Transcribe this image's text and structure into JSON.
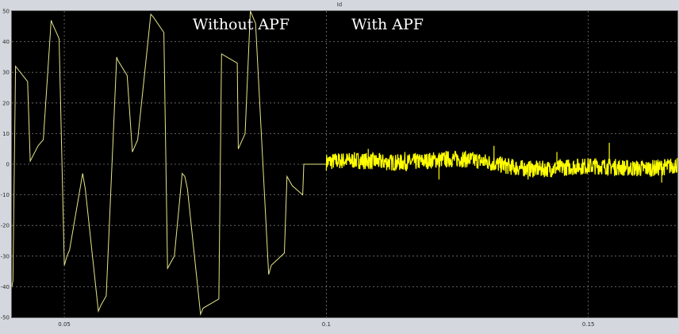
{
  "window": {
    "title": "Id"
  },
  "chart_data": {
    "type": "line",
    "title": "Id",
    "xlabel": "",
    "ylabel": "",
    "xlim": [
      0.04,
      0.167
    ],
    "ylim": [
      -50,
      50
    ],
    "x_ticks": [
      0.05,
      0.1,
      0.15
    ],
    "x_tick_labels": [
      "0.05",
      "0.1",
      "0.15"
    ],
    "y_ticks": [
      50,
      40,
      30,
      20,
      10,
      0,
      -10,
      -20,
      -30,
      -40,
      -50
    ],
    "y_tick_labels": [
      "50",
      "40",
      "30",
      "20",
      "10",
      "0",
      "-10",
      "-20",
      "-30",
      "-40",
      "-50"
    ],
    "grid": true,
    "background": "#000000",
    "line_color": "#ffff00",
    "annotations": [
      {
        "text": "Without APF",
        "x": 0.0745,
        "y": 44
      },
      {
        "text": "With APF",
        "x": 0.1048,
        "y": 44
      }
    ],
    "series": [
      {
        "segment": "without_apf",
        "x": [
          0.04,
          0.0402,
          0.0407,
          0.043,
          0.0435,
          0.045,
          0.046,
          0.0475,
          0.0477,
          0.049,
          0.05,
          0.0505,
          0.051,
          0.0535,
          0.054,
          0.0565,
          0.057,
          0.058,
          0.06,
          0.0602,
          0.062,
          0.063,
          0.0635,
          0.064,
          0.0665,
          0.067,
          0.069,
          0.0697,
          0.071,
          0.0725,
          0.073,
          0.0735,
          0.076,
          0.0765,
          0.0795,
          0.08,
          0.083,
          0.0832,
          0.0845,
          0.0855,
          0.086,
          0.0865,
          0.089,
          0.0895,
          0.092,
          0.0925,
          0.0935,
          0.0955,
          0.0957,
          0.097,
          0.0985,
          0.1
        ],
        "y": [
          -40,
          -38,
          32,
          27,
          1,
          6,
          8,
          47,
          46,
          41,
          -33,
          -30,
          -28,
          -3,
          -8,
          -48,
          -46,
          -43,
          35,
          34,
          29,
          4,
          6,
          8,
          49,
          48,
          43,
          -34,
          -30,
          -3,
          -4,
          -8,
          -49,
          -47,
          -44,
          36,
          33,
          5,
          10,
          50,
          48,
          46,
          -36,
          -33,
          -29,
          -4,
          -7,
          -10,
          0,
          0,
          0,
          0
        ]
      },
      {
        "segment": "with_apf",
        "x_range": [
          0.1,
          0.167
        ],
        "baseline": 0,
        "noise_band": [
          -5,
          5
        ],
        "spikes": [
          {
            "x": 0.108,
            "y": 5
          },
          {
            "x": 0.115,
            "y": 4
          },
          {
            "x": 0.1215,
            "y": -5
          },
          {
            "x": 0.132,
            "y": 6
          },
          {
            "x": 0.1385,
            "y": -5
          },
          {
            "x": 0.144,
            "y": 4
          },
          {
            "x": 0.154,
            "y": 7
          },
          {
            "x": 0.164,
            "y": -6
          }
        ]
      }
    ]
  }
}
